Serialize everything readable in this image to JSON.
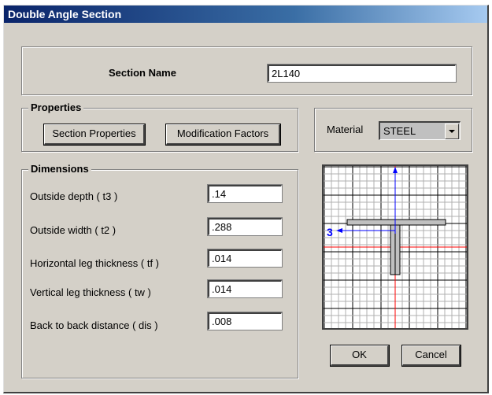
{
  "window": {
    "title": "Double Angle Section"
  },
  "section_name": {
    "label": "Section Name",
    "value": "2L140"
  },
  "properties": {
    "legend": "Properties",
    "section_properties_button": "Section Properties",
    "modification_factors_button": "Modification Factors"
  },
  "material": {
    "label": "Material",
    "selected": "STEEL"
  },
  "dimensions": {
    "legend": "Dimensions",
    "rows": [
      {
        "label": "Outside depth  ( t3 )",
        "value": ".14"
      },
      {
        "label": "Outside width  ( t2 )",
        "value": ".288"
      },
      {
        "label": "Horizontal leg thickness  ( tf )",
        "value": ".014"
      },
      {
        "label": "Vertical leg thickness  ( tw )",
        "value": ".014"
      },
      {
        "label": "Back to back distance  ( dis )",
        "value": ".008"
      }
    ]
  },
  "preview": {
    "axis_label": "3"
  },
  "buttons": {
    "ok": "OK",
    "cancel": "Cancel"
  },
  "colors": {
    "axis": "#0000ff",
    "centerline": "#ff0000",
    "section_fill": "#c0c0c0"
  }
}
